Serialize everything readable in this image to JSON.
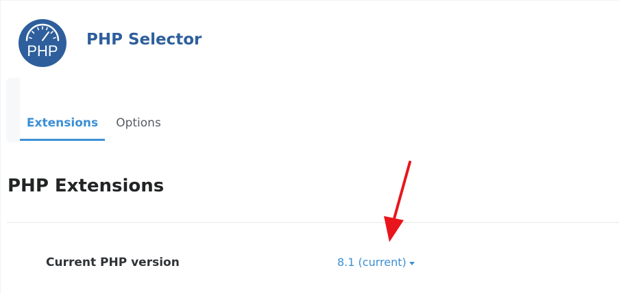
{
  "app": {
    "logo_text": "PHP",
    "title": "PHP Selector"
  },
  "tabs": [
    {
      "label": "Extensions",
      "active": true
    },
    {
      "label": "Options",
      "active": false
    }
  ],
  "section": {
    "title": "PHP Extensions"
  },
  "php_version": {
    "label": "Current PHP version",
    "value": "8.1 (current)"
  },
  "colors": {
    "brand": "#2e5f9c",
    "accent": "#3b8fd4",
    "annotation": "#e8161c"
  },
  "icons": {
    "logo": "php-gauge-logo",
    "dropdown": "caret-down-icon",
    "annotation": "red-arrow"
  }
}
